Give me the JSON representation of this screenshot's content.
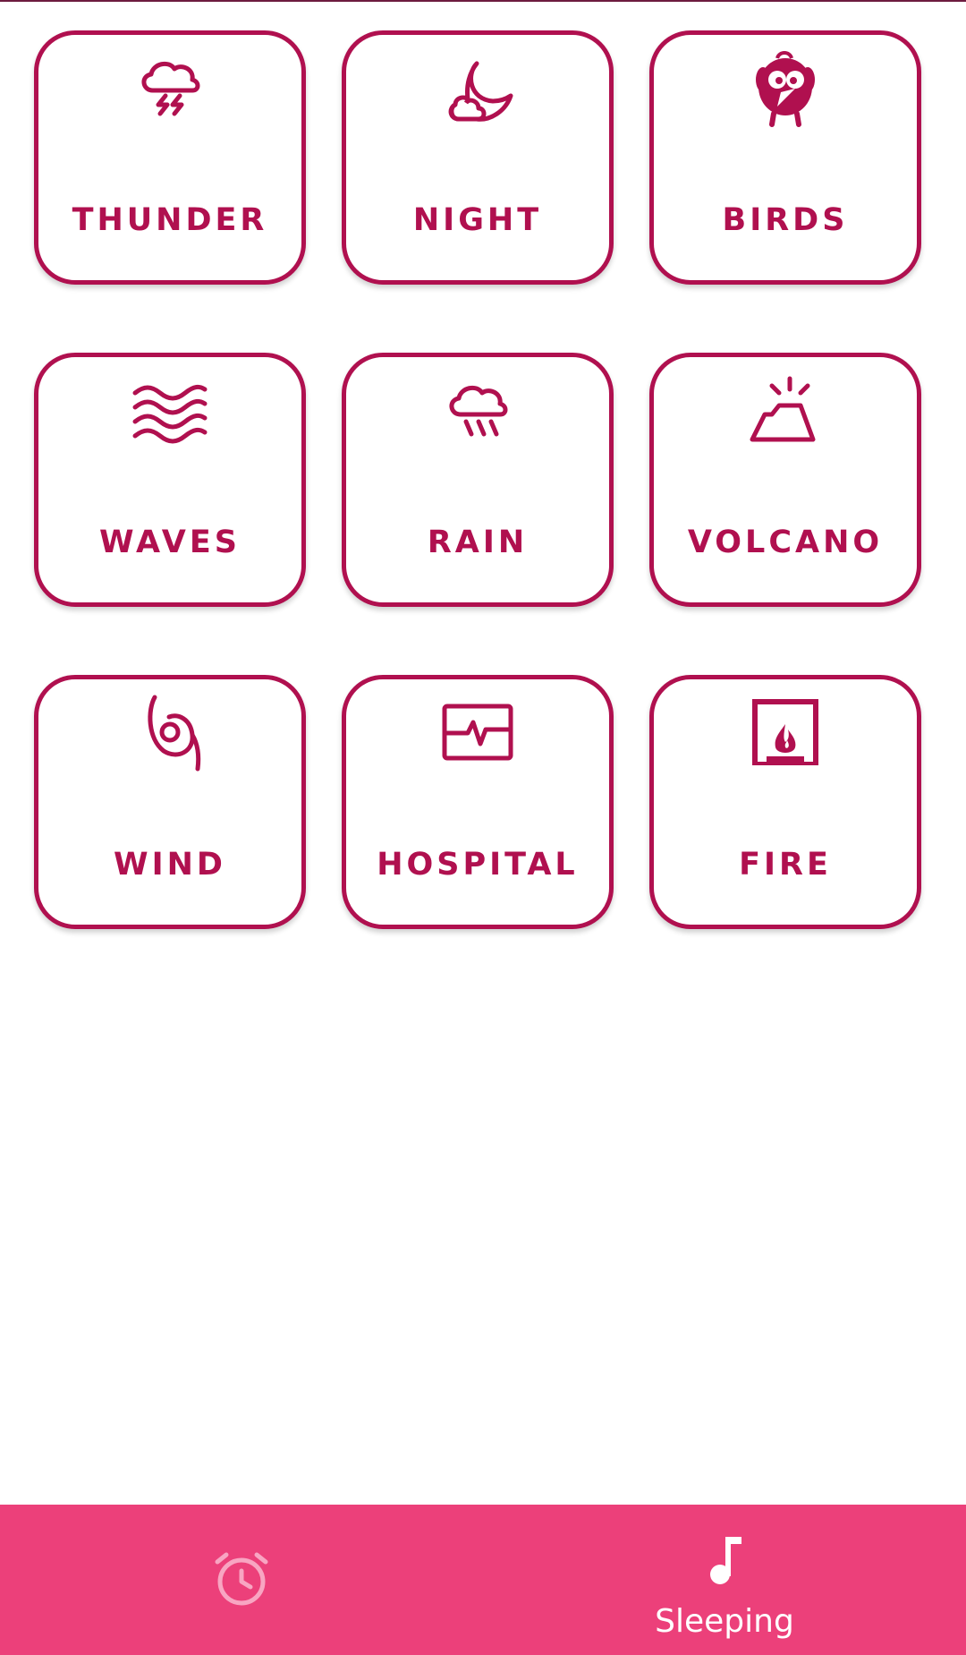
{
  "colors": {
    "accent": "#b0104f",
    "nav_background": "#ec407a",
    "nav_active": "#ffffff",
    "nav_inactive": "#f8a5c2"
  },
  "sounds": [
    {
      "label": "THUNDER",
      "icon": "thunderstorm-icon"
    },
    {
      "label": "NIGHT",
      "icon": "moon-cloud-icon"
    },
    {
      "label": "BIRDS",
      "icon": "bird-icon"
    },
    {
      "label": "WAVES",
      "icon": "waves-icon"
    },
    {
      "label": "RAIN",
      "icon": "rain-icon"
    },
    {
      "label": "VOLCANO",
      "icon": "volcano-icon"
    },
    {
      "label": "WIND",
      "icon": "cyclone-icon"
    },
    {
      "label": "HOSPITAL",
      "icon": "heart-monitor-icon"
    },
    {
      "label": "FIRE",
      "icon": "fireplace-icon"
    }
  ],
  "bottom_nav": {
    "items": [
      {
        "label": "",
        "icon": "alarm-clock-icon",
        "active": false
      },
      {
        "label": "Sleeping",
        "icon": "music-note-icon",
        "active": true
      }
    ]
  }
}
